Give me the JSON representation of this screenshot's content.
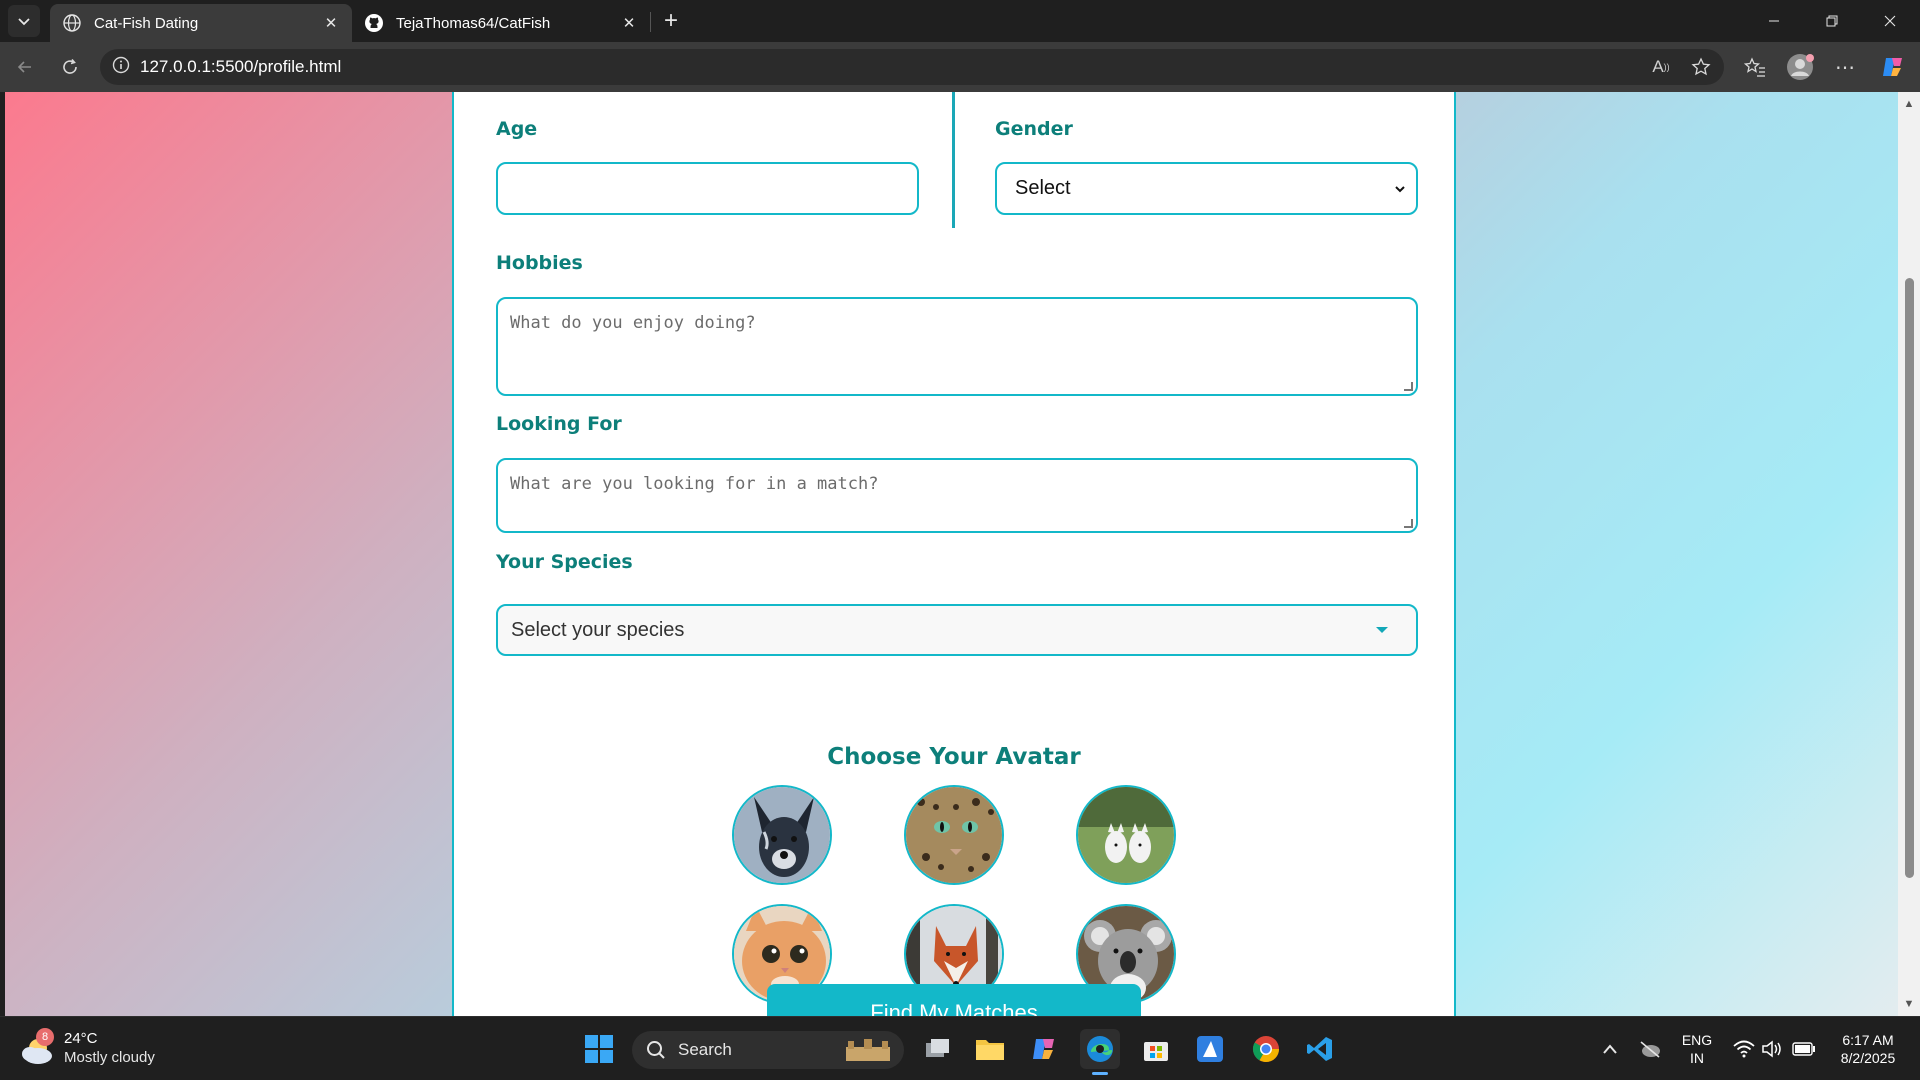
{
  "browser": {
    "tabs": [
      {
        "title": "Cat-Fish Dating",
        "active": true
      },
      {
        "title": "TejaThomas64/CatFish",
        "active": false
      }
    ],
    "url": "127.0.0.1:5500/profile.html"
  },
  "form": {
    "age_label": "Age",
    "age_value": "",
    "gender_label": "Gender",
    "gender_selected": "Select",
    "hobbies_label": "Hobbies",
    "hobbies_placeholder": "What do you enjoy doing?",
    "looking_for_label": "Looking For",
    "looking_for_placeholder": "What are you looking for in a match?",
    "species_label": "Your Species",
    "species_selected": "Select your species",
    "avatar_title": "Choose Your Avatar",
    "avatars": [
      "dog avatar",
      "leopard avatar",
      "white dogs avatar",
      "orange cat avatar",
      "fox avatar",
      "koala avatar"
    ],
    "submit_label": "Find My Matches"
  },
  "taskbar": {
    "weather_badge": "8",
    "temperature": "24°C",
    "condition": "Mostly cloudy",
    "search_label": "Search",
    "language_line1": "ENG",
    "language_line2": "IN",
    "time": "6:17 AM",
    "date": "8/2/2025"
  },
  "colors": {
    "accent": "#13b8c9",
    "label": "#0d7f7a",
    "page_gradient_start": "#fb7a8e",
    "page_gradient_end": "#a6ebf6"
  }
}
